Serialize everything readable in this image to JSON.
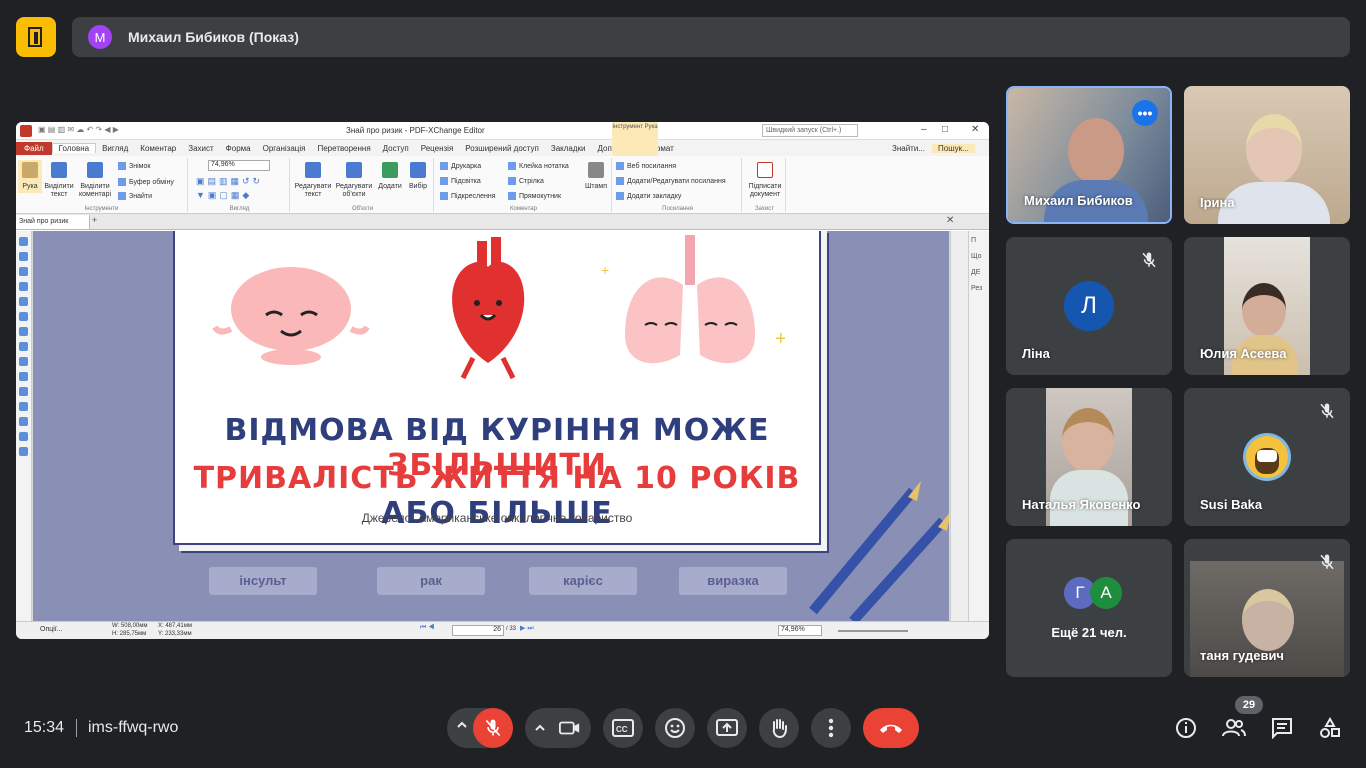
{
  "presenter": {
    "initial": "М",
    "label": "Михаил Бибиков (Показ)"
  },
  "editor": {
    "title": "Знай про ризик - PDF-XChange Editor",
    "quick_launch": "Швидкий запуск (Ctrl+.)",
    "menu": [
      "Файл",
      "Головна",
      "Вигляд",
      "Коментар",
      "Захист",
      "Форма",
      "Організація",
      "Перетворення",
      "Доступ",
      "Рецензія",
      "Розширений доступ",
      "Закладки",
      "Допомога",
      "Формат"
    ],
    "context_tab": "Інструмент Рука",
    "search_items": [
      "Знайти...",
      "Пошук..."
    ],
    "ribbon": {
      "hand": "Рука",
      "select_text": "Виділити текст",
      "select_comments": "Виділити коментарі",
      "snapshot": "Знімок",
      "clipboard": "Буфер обміну",
      "find": "Знайти",
      "zoom": "74,96%",
      "edit_text": "Редагувати текст",
      "edit_objects": "Редагувати об'єкти",
      "add": "Додати",
      "select": "Вибір",
      "typewriter": "Друкарка",
      "highlight": "Підсвітка",
      "underline": "Підкреслення",
      "sticky": "Клейка нотатка",
      "arrow": "Стрілка",
      "rectangle": "Прямокутник",
      "stamp": "Штамп",
      "web_links": "Веб посилання",
      "add_edit_links": "Додати/Редагувати посилання",
      "add_bookmark": "Додати закладку",
      "sign": "Підписати документ",
      "groups": [
        "Інструменти",
        "Вигляд",
        "Об'єкти",
        "Коментар",
        "Посилання",
        "Захист"
      ]
    },
    "doc_tab": "Знай про ризик",
    "slide": {
      "line1_a": "ВІДМОВА ВІД КУРІННЯ МОЖЕ",
      "line1_b": "ЗБІЛЬШИТИ",
      "line2_a": "ТРИВАЛІСТЬ ЖИТТЯ НА 10 РОКІВ",
      "line2_b": "АБО БІЛЬШЕ",
      "source": "Джерело: Американське онкологічне товариство",
      "chips": [
        "інсульт",
        "рак",
        "карієс",
        "виразка"
      ]
    },
    "status": {
      "options": "Опції...",
      "width": "W: 508,00мм",
      "height": "H: 285,75мм",
      "x": "X: 487,41мм",
      "y": "Y: 233,33мм",
      "page": "26",
      "page_total": "/ 33",
      "zoom": "74,96%"
    },
    "side_panel": [
      "П",
      "Що",
      "ДЕ",
      "Рез"
    ]
  },
  "participants": [
    {
      "name": "Михаил Бибиков",
      "video": true,
      "muted": false
    },
    {
      "name": "Ірина",
      "video": true,
      "muted": false
    },
    {
      "name": "Ліна",
      "initial": "Л",
      "color": "#1557b0",
      "muted": true
    },
    {
      "name": "Юлия Асеева",
      "video": true,
      "muted": false
    },
    {
      "name": "Наталья Яковенко",
      "video": true,
      "muted": false
    },
    {
      "name": "Susi Baka",
      "avatar": "emoji",
      "muted": true
    },
    {
      "name": "Ещё 21 чел.",
      "initials": [
        "Г",
        "А"
      ],
      "colors": [
        "#5c6bc0",
        "#1e8e3e"
      ]
    },
    {
      "name": "таня гудевич",
      "video": true,
      "muted": true
    }
  ],
  "meeting": {
    "time": "15:34",
    "code": "ims-ffwq-rwo",
    "participant_count": "29"
  },
  "colors": {
    "end_call": "#ea4335",
    "accent": "#8ab4f8",
    "logo": "#fbbc04"
  }
}
